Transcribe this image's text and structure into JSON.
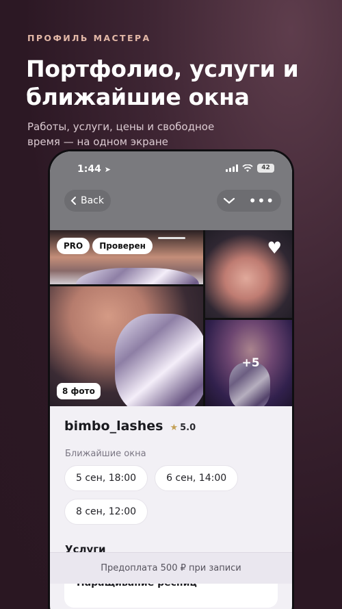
{
  "promo": {
    "eyebrow": "ПРОФИЛЬ МАСТЕРА",
    "headline": "Портфолио, услуги и ближайшие окна",
    "subtitle": "Работы, услуги, цены и свободное время — на одном экране"
  },
  "status_bar": {
    "time": "1:44",
    "battery": "42"
  },
  "nav": {
    "back_label": "Back"
  },
  "gallery": {
    "badges": [
      "PRO",
      "Проверен"
    ],
    "photo_count_label": "8 фото",
    "more_label": "+5"
  },
  "profile": {
    "name": "bimbo_lashes",
    "rating": "5.0",
    "slots_label": "Ближайшие окна",
    "slots": [
      "5 сен, 18:00",
      "6 сен, 14:00",
      "8 сен, 12:00"
    ],
    "services_title": "Услуги",
    "service_first": "Наращивание ресниц"
  },
  "footer": {
    "prepay_text": "Предоплата 500 ₽ при записи"
  },
  "colors": {
    "background": "#3e2533",
    "eyebrow": "#e3b8a7",
    "star": "#c4a055"
  }
}
